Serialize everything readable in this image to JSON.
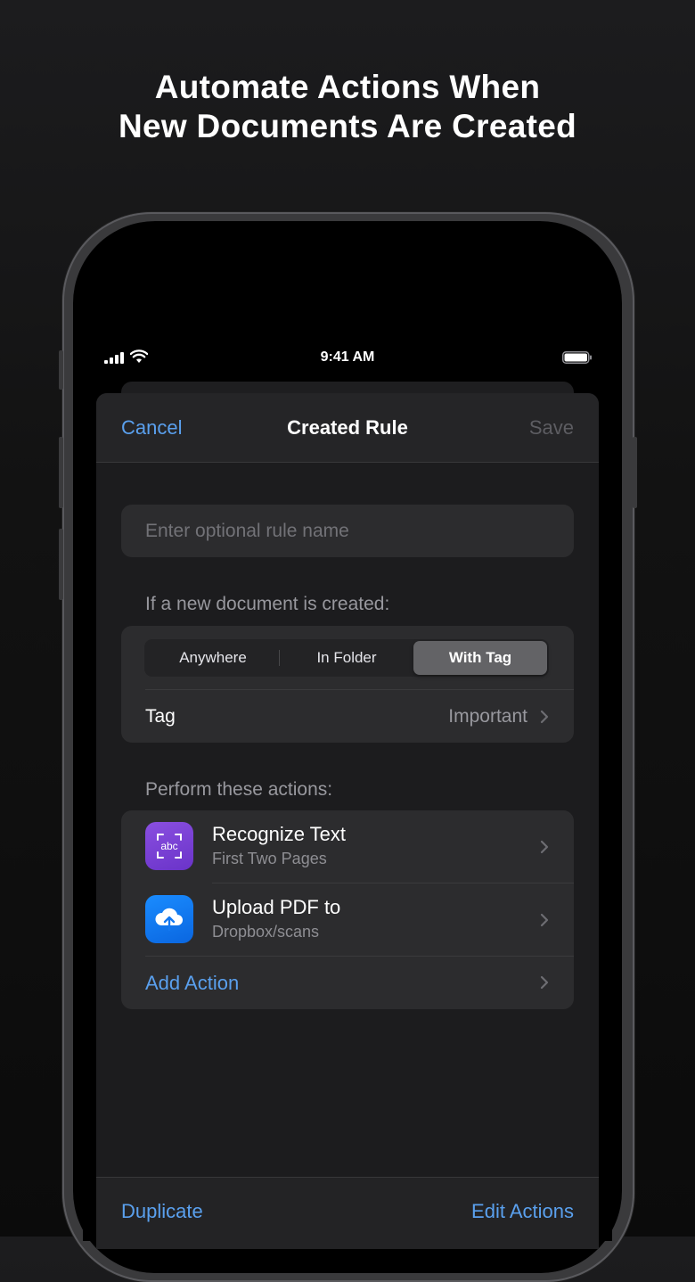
{
  "headline": {
    "line1": "Automate Actions When",
    "line2": "New Documents Are Created"
  },
  "status_bar": {
    "time": "9:41 AM",
    "icons": [
      "signal-icon",
      "wifi-icon",
      "battery-icon"
    ]
  },
  "nav": {
    "cancel": "Cancel",
    "title": "Created Rule",
    "save": "Save"
  },
  "rule_name": {
    "placeholder": "Enter optional rule name",
    "value": ""
  },
  "trigger": {
    "header": "If a new document is created:",
    "segments": [
      "Anywhere",
      "In Folder",
      "With Tag"
    ],
    "selected_segment": "With Tag",
    "tag_label": "Tag",
    "tag_value": "Important"
  },
  "actions": {
    "header": "Perform these actions:",
    "items": [
      {
        "title": "Recognize Text",
        "subtitle": "First Two Pages",
        "icon": "ocr-icon",
        "icon_text": "abc",
        "color": "#7a40d8"
      },
      {
        "title": "Upload PDF to",
        "subtitle": "Dropbox/scans",
        "icon": "cloud-upload-icon",
        "color": "#1478f0"
      }
    ],
    "add_label": "Add Action"
  },
  "toolbar": {
    "left": "Duplicate",
    "right": "Edit Actions"
  },
  "colors": {
    "accent": "#5aa0ee",
    "background": "#1c1c1e",
    "cell": "#2c2c2e"
  }
}
